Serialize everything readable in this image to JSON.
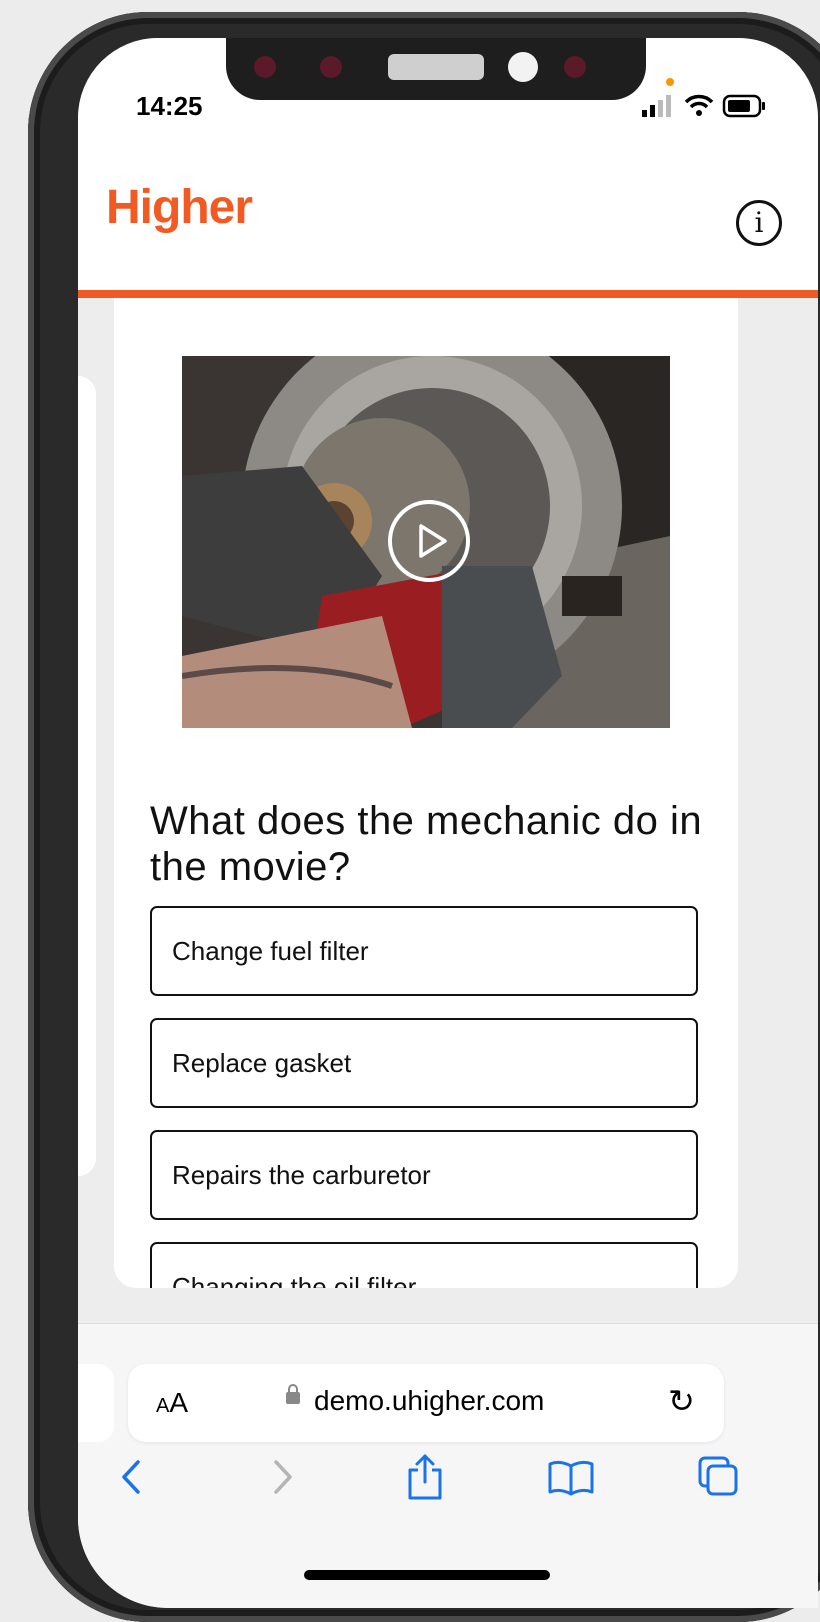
{
  "status_bar": {
    "time": "14:25"
  },
  "header": {
    "logo": "Higher",
    "info_icon": "i"
  },
  "quiz": {
    "question": "What does the mechanic do in the movie?",
    "answers": [
      {
        "label": "Change fuel filter"
      },
      {
        "label": "Replace gasket"
      },
      {
        "label": "Repairs the carburetor"
      },
      {
        "label": "Changing the oil filter"
      }
    ]
  },
  "browser": {
    "text_size_label": "AA",
    "url": "demo.uhigher.com",
    "toolbar_icons": [
      "back-icon",
      "forward-icon",
      "share-icon",
      "bookmarks-icon",
      "tabs-icon"
    ]
  },
  "colors": {
    "brand": "#f15a22",
    "background": "#ededed",
    "text": "#111111"
  }
}
